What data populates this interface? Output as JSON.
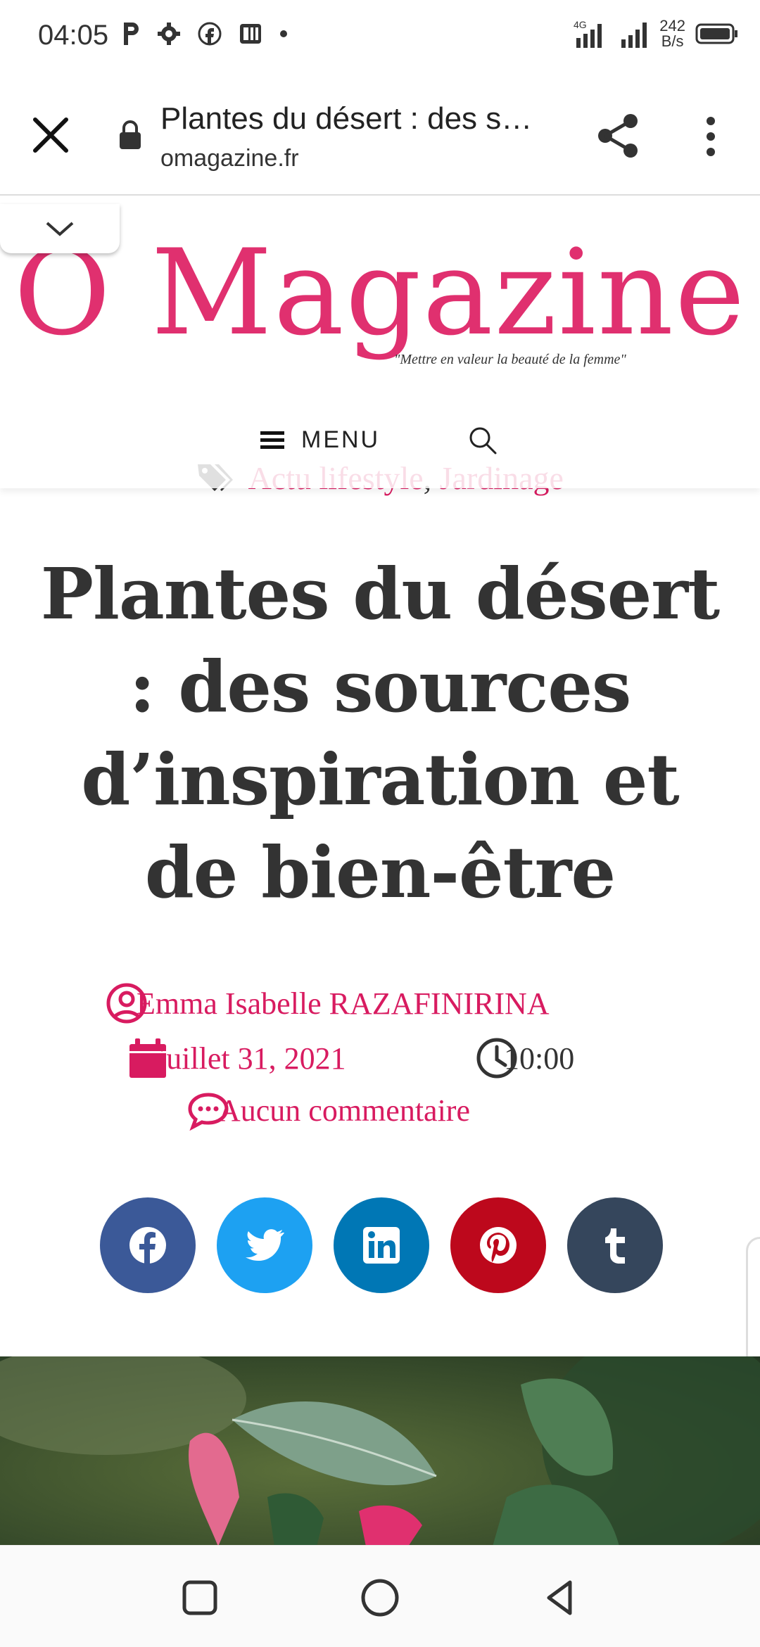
{
  "status": {
    "time": "04:05",
    "network": "4G",
    "speed_value": "242",
    "speed_unit": "B/s"
  },
  "browser": {
    "title": "Plantes du désert : des s…",
    "domain": "omagazine.fr"
  },
  "site": {
    "logo": "Ô Magazine",
    "tagline": "\"Mettre en valeur la beauté de la femme\"",
    "menu_label": "MENU"
  },
  "article": {
    "categories": [
      "Actu lifestyle",
      "Jardinage"
    ],
    "category_separator": ", ",
    "title": "Plantes du désert : des sources d’inspiration et de bien-être",
    "author": "Emma Isabelle RAZAFINIRINA",
    "date": "juillet 31, 2021",
    "time": "10:00",
    "comments": "Aucun commentaire"
  },
  "share_buttons": [
    {
      "network": "facebook",
      "color": "#3b5998"
    },
    {
      "network": "twitter",
      "color": "#1da1f2"
    },
    {
      "network": "linkedin",
      "color": "#0077b5"
    },
    {
      "network": "pinterest",
      "color": "#bd081c"
    },
    {
      "network": "tumblr",
      "color": "#35465c"
    }
  ],
  "colors": {
    "accent": "#d81b60",
    "logo": "#e0306f",
    "title": "#333333"
  }
}
